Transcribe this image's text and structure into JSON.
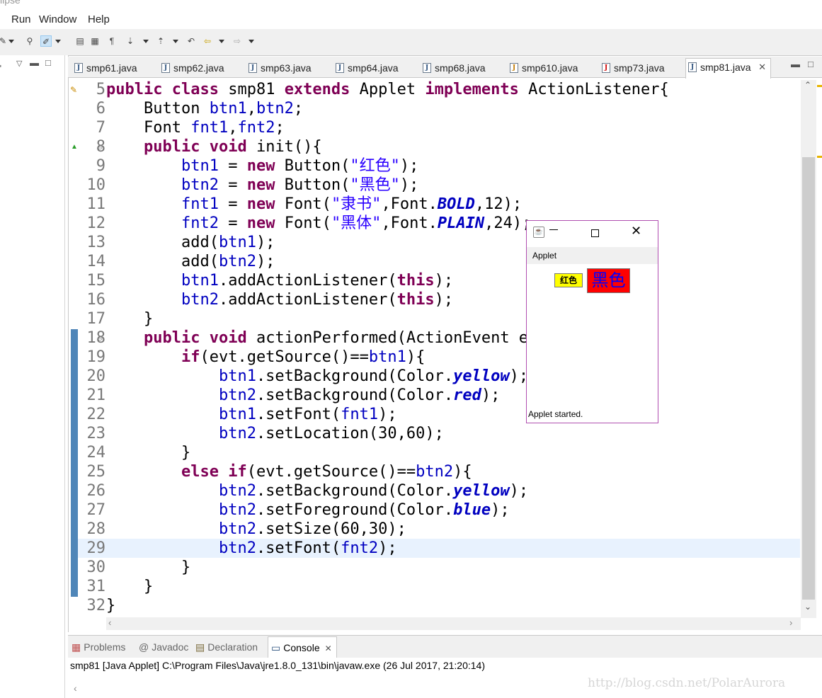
{
  "app": {
    "title_fragment": "lipse"
  },
  "menu": [
    "Run",
    "Window",
    "Help"
  ],
  "tabs": [
    {
      "label": "smp61.java"
    },
    {
      "label": "smp62.java"
    },
    {
      "label": "smp63.java"
    },
    {
      "label": "smp64.java"
    },
    {
      "label": "smp68.java"
    },
    {
      "label": "smp610.java"
    },
    {
      "label": "smp73.java"
    },
    {
      "label": "smp81.java",
      "active": true
    }
  ],
  "code": [
    {
      "n": "5",
      "parts": [
        [
          "kw",
          "public"
        ],
        [
          "t",
          " "
        ],
        [
          "kw",
          "class"
        ],
        [
          "t",
          " smp81 "
        ],
        [
          "kw",
          "extends"
        ],
        [
          "t",
          " Applet "
        ],
        [
          "kw",
          "implements"
        ],
        [
          "t",
          " ActionListener{"
        ]
      ]
    },
    {
      "n": "6",
      "parts": [
        [
          "t",
          "    Button "
        ],
        [
          "fld",
          "btn1"
        ],
        [
          "t",
          ","
        ],
        [
          "fld",
          "btn2"
        ],
        [
          "t",
          ";"
        ]
      ]
    },
    {
      "n": "7",
      "parts": [
        [
          "t",
          "    Font "
        ],
        [
          "fld",
          "fnt1"
        ],
        [
          "t",
          ","
        ],
        [
          "fld",
          "fnt2"
        ],
        [
          "t",
          ";"
        ]
      ]
    },
    {
      "n": "8",
      "parts": [
        [
          "t",
          "    "
        ],
        [
          "kw",
          "public"
        ],
        [
          "t",
          " "
        ],
        [
          "kw",
          "void"
        ],
        [
          "t",
          " init(){"
        ]
      ]
    },
    {
      "n": "9",
      "parts": [
        [
          "t",
          "        "
        ],
        [
          "fld",
          "btn1"
        ],
        [
          "t",
          " = "
        ],
        [
          "kw",
          "new"
        ],
        [
          "t",
          " Button("
        ],
        [
          "str",
          "\"红色\""
        ],
        [
          "t",
          ");"
        ]
      ]
    },
    {
      "n": "10",
      "parts": [
        [
          "t",
          "        "
        ],
        [
          "fld",
          "btn2"
        ],
        [
          "t",
          " = "
        ],
        [
          "kw",
          "new"
        ],
        [
          "t",
          " Button("
        ],
        [
          "str",
          "\"黑色\""
        ],
        [
          "t",
          ");"
        ]
      ]
    },
    {
      "n": "11",
      "parts": [
        [
          "t",
          "        "
        ],
        [
          "fld",
          "fnt1"
        ],
        [
          "t",
          " = "
        ],
        [
          "kw",
          "new"
        ],
        [
          "t",
          " Font("
        ],
        [
          "str",
          "\"隶书\""
        ],
        [
          "t",
          ",Font."
        ],
        [
          "cst",
          "BOLD"
        ],
        [
          "t",
          ",12);"
        ]
      ]
    },
    {
      "n": "12",
      "parts": [
        [
          "t",
          "        "
        ],
        [
          "fld",
          "fnt2"
        ],
        [
          "t",
          " = "
        ],
        [
          "kw",
          "new"
        ],
        [
          "t",
          " Font("
        ],
        [
          "str",
          "\"黑体\""
        ],
        [
          "t",
          ",Font."
        ],
        [
          "cst",
          "PLAIN"
        ],
        [
          "t",
          ",24);"
        ]
      ]
    },
    {
      "n": "13",
      "parts": [
        [
          "t",
          "        add("
        ],
        [
          "fld",
          "btn1"
        ],
        [
          "t",
          ");"
        ]
      ]
    },
    {
      "n": "14",
      "parts": [
        [
          "t",
          "        add("
        ],
        [
          "fld",
          "btn2"
        ],
        [
          "t",
          ");"
        ]
      ]
    },
    {
      "n": "15",
      "parts": [
        [
          "t",
          "        "
        ],
        [
          "fld",
          "btn1"
        ],
        [
          "t",
          ".addActionListener("
        ],
        [
          "kw",
          "this"
        ],
        [
          "t",
          ");"
        ]
      ]
    },
    {
      "n": "16",
      "parts": [
        [
          "t",
          "        "
        ],
        [
          "fld",
          "btn2"
        ],
        [
          "t",
          ".addActionListener("
        ],
        [
          "kw",
          "this"
        ],
        [
          "t",
          ");"
        ]
      ]
    },
    {
      "n": "17",
      "parts": [
        [
          "t",
          "    }"
        ]
      ]
    },
    {
      "n": "18",
      "parts": [
        [
          "t",
          "    "
        ],
        [
          "kw",
          "public"
        ],
        [
          "t",
          " "
        ],
        [
          "kw",
          "void"
        ],
        [
          "t",
          " actionPerformed(ActionEvent ev"
        ]
      ]
    },
    {
      "n": "19",
      "parts": [
        [
          "t",
          "        "
        ],
        [
          "kw",
          "if"
        ],
        [
          "t",
          "(evt.getSource()=="
        ],
        [
          "fld",
          "btn1"
        ],
        [
          "t",
          "){"
        ]
      ]
    },
    {
      "n": "20",
      "parts": [
        [
          "t",
          "            "
        ],
        [
          "fld",
          "btn1"
        ],
        [
          "t",
          ".setBackground(Color."
        ],
        [
          "cst",
          "yellow"
        ],
        [
          "t",
          ");"
        ]
      ]
    },
    {
      "n": "21",
      "parts": [
        [
          "t",
          "            "
        ],
        [
          "fld",
          "btn2"
        ],
        [
          "t",
          ".setBackground(Color."
        ],
        [
          "cst",
          "red"
        ],
        [
          "t",
          ");"
        ]
      ]
    },
    {
      "n": "22",
      "parts": [
        [
          "t",
          "            "
        ],
        [
          "fld",
          "btn1"
        ],
        [
          "t",
          ".setFont("
        ],
        [
          "fld",
          "fnt1"
        ],
        [
          "t",
          ");"
        ]
      ]
    },
    {
      "n": "23",
      "parts": [
        [
          "t",
          "            "
        ],
        [
          "fld",
          "btn2"
        ],
        [
          "t",
          ".setLocation(30,60);"
        ]
      ]
    },
    {
      "n": "24",
      "parts": [
        [
          "t",
          "        }"
        ]
      ]
    },
    {
      "n": "25",
      "parts": [
        [
          "t",
          "        "
        ],
        [
          "kw",
          "else"
        ],
        [
          "t",
          " "
        ],
        [
          "kw",
          "if"
        ],
        [
          "t",
          "(evt.getSource()=="
        ],
        [
          "fld",
          "btn2"
        ],
        [
          "t",
          "){"
        ]
      ]
    },
    {
      "n": "26",
      "parts": [
        [
          "t",
          "            "
        ],
        [
          "fld",
          "btn2"
        ],
        [
          "t",
          ".setBackground(Color."
        ],
        [
          "cst",
          "yellow"
        ],
        [
          "t",
          ");"
        ]
      ]
    },
    {
      "n": "27",
      "parts": [
        [
          "t",
          "            "
        ],
        [
          "fld",
          "btn2"
        ],
        [
          "t",
          ".setForeground(Color."
        ],
        [
          "cst",
          "blue"
        ],
        [
          "t",
          ");"
        ]
      ]
    },
    {
      "n": "28",
      "parts": [
        [
          "t",
          "            "
        ],
        [
          "fld",
          "btn2"
        ],
        [
          "t",
          ".setSize(60,30);"
        ]
      ]
    },
    {
      "n": "29",
      "parts": [
        [
          "t",
          "            "
        ],
        [
          "fld",
          "btn2"
        ],
        [
          "t",
          ".setFont("
        ],
        [
          "fld",
          "fnt2"
        ],
        [
          "t",
          ");"
        ]
      ],
      "current": true
    },
    {
      "n": "30",
      "parts": [
        [
          "t",
          "        }"
        ]
      ]
    },
    {
      "n": "31",
      "parts": [
        [
          "t",
          "    }"
        ]
      ]
    },
    {
      "n": "32",
      "parts": [
        [
          "t",
          "}"
        ]
      ]
    }
  ],
  "applet": {
    "menu_label": "Applet",
    "btn1_label": "红色",
    "btn2_label": "黑色",
    "status": "Applet started.",
    "colors": {
      "btn1_bg": "#ffff00",
      "btn2_bg": "#ff0000",
      "btn2_fg": "#0000ff"
    }
  },
  "bottom_tabs": [
    {
      "label": "Problems"
    },
    {
      "label": "Javadoc"
    },
    {
      "label": "Declaration"
    },
    {
      "label": "Console",
      "active": true
    }
  ],
  "console": {
    "text": "smp81 [Java Applet] C:\\Program Files\\Java\\jre1.8.0_131\\bin\\javaw.exe (26 Jul 2017, 21:20:14)"
  },
  "watermark": "http://blog.csdn.net/PolarAurora"
}
